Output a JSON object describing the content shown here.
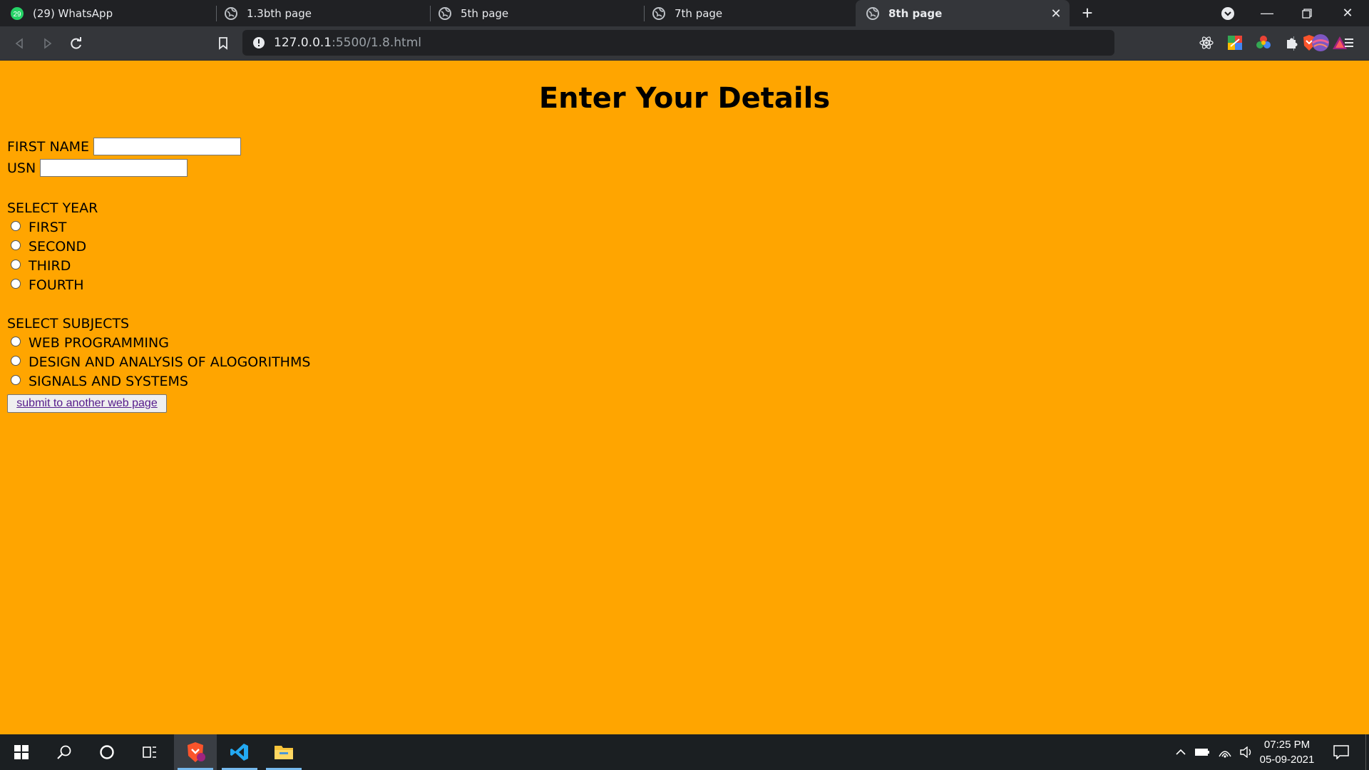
{
  "browser": {
    "tabs": [
      {
        "label": "(29) WhatsApp",
        "icon": "whatsapp-icon",
        "badge": "29"
      },
      {
        "label": "1.3bth page",
        "icon": "globe-icon"
      },
      {
        "label": "5th page",
        "icon": "globe-icon"
      },
      {
        "label": "7th page",
        "icon": "globe-icon"
      },
      {
        "label": "8th page",
        "icon": "globe-icon",
        "active": true
      }
    ],
    "address": {
      "host": "127.0.0.1",
      "path": ":5500/1.8.html"
    }
  },
  "page": {
    "title": "Enter Your Details",
    "first_name_label": "FIRST NAME",
    "usn_label": "USN",
    "first_name_value": "",
    "usn_value": "",
    "year_heading": "SELECT YEAR",
    "years": [
      "FIRST",
      "SECOND",
      "THIRD",
      "FOURTH"
    ],
    "subjects_heading": "SELECT SUBJECTS",
    "subjects": [
      "WEB PROGRAMMING",
      "DESIGN AND ANALYSIS OF ALOGORITHMS",
      "SIGNALS AND SYSTEMS"
    ],
    "submit_label": "submit to another web page"
  },
  "taskbar": {
    "time": "07:25 PM",
    "date": "05-09-2021"
  },
  "colors": {
    "page_background": "#ffa500",
    "tabbar": "#202124",
    "toolbar": "#34363a",
    "taskbar": "#1b1f22"
  }
}
